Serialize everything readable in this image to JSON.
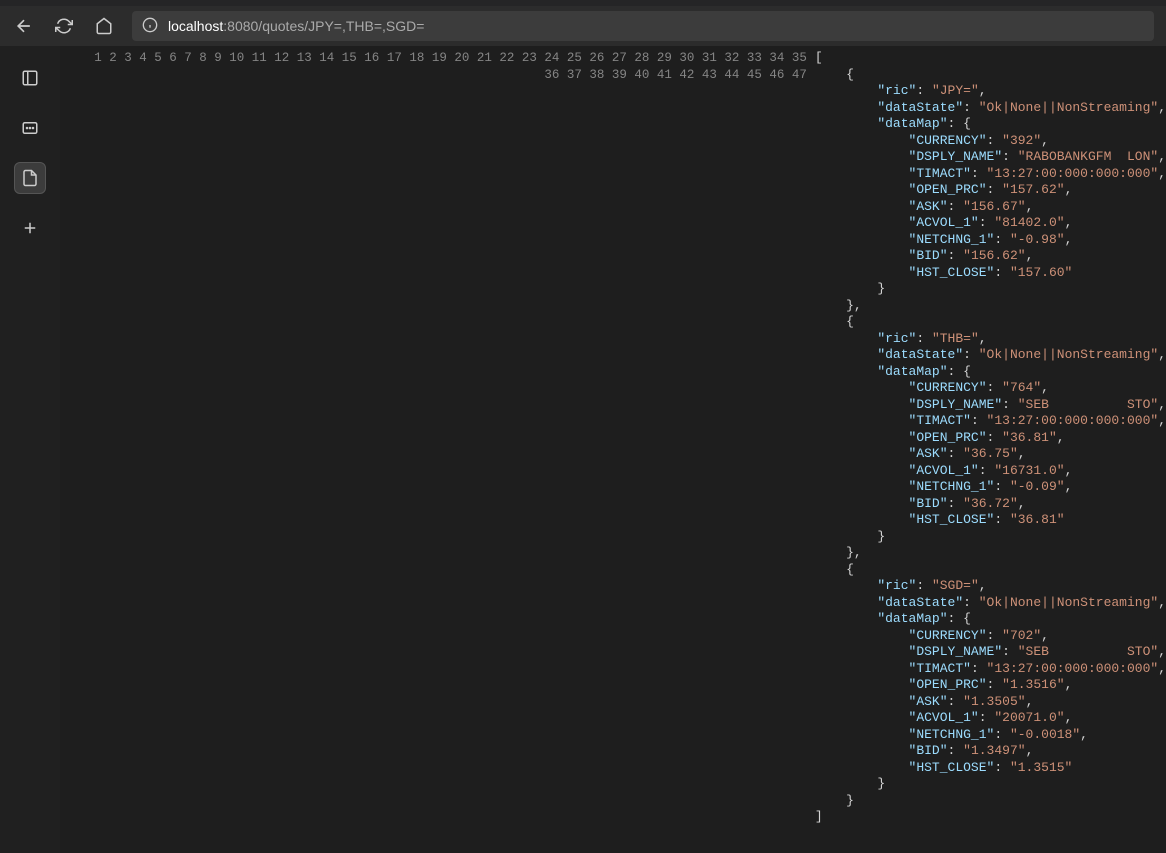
{
  "url": {
    "host": "localhost",
    "port_path": ":8080/quotes/JPY=,THB=,SGD="
  },
  "json_keys": {
    "ric": "ric",
    "dataState": "dataState",
    "dataMap": "dataMap",
    "CURRENCY": "CURRENCY",
    "DSPLY_NAME": "DSPLY_NAME",
    "TIMACT": "TIMACT",
    "OPEN_PRC": "OPEN_PRC",
    "ASK": "ASK",
    "ACVOL_1": "ACVOL_1",
    "NETCHNG_1": "NETCHNG_1",
    "BID": "BID",
    "HST_CLOSE": "HST_CLOSE"
  },
  "quotes": [
    {
      "ric": "JPY=",
      "dataState": "Ok|None||NonStreaming",
      "CURRENCY": "392",
      "DSPLY_NAME": "RABOBANKGFM  LON",
      "TIMACT": "13:27:00:000:000:000",
      "OPEN_PRC": "157.62",
      "ASK": "156.67",
      "ACVOL_1": "81402.0",
      "NETCHNG_1": "-0.98",
      "BID": "156.62",
      "HST_CLOSE": "157.60"
    },
    {
      "ric": "THB=",
      "dataState": "Ok|None||NonStreaming",
      "CURRENCY": "764",
      "DSPLY_NAME": "SEB          STO",
      "TIMACT": "13:27:00:000:000:000",
      "OPEN_PRC": "36.81",
      "ASK": "36.75",
      "ACVOL_1": "16731.0",
      "NETCHNG_1": "-0.09",
      "BID": "36.72",
      "HST_CLOSE": "36.81"
    },
    {
      "ric": "SGD=",
      "dataState": "Ok|None||NonStreaming",
      "CURRENCY": "702",
      "DSPLY_NAME": "SEB          STO",
      "TIMACT": "13:27:00:000:000:000",
      "OPEN_PRC": "1.3516",
      "ASK": "1.3505",
      "ACVOL_1": "20071.0",
      "NETCHNG_1": "-0.0018",
      "BID": "1.3497",
      "HST_CLOSE": "1.3515"
    }
  ],
  "line_count": 47
}
